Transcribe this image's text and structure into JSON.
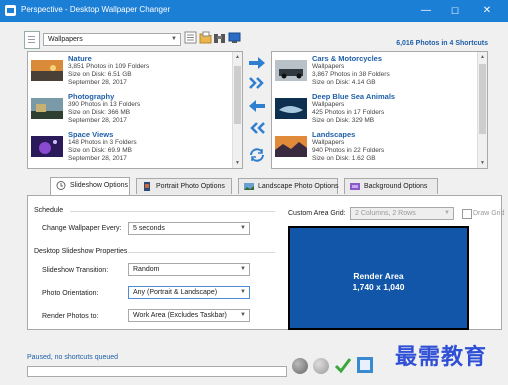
{
  "window": {
    "title": "Perspective - Desktop Wallpaper Changer",
    "minimize": "—",
    "maximize": "☐",
    "close": "✕"
  },
  "toolbar": {
    "shortcut_value": "Wallpapers",
    "shortcut_count": "6,016 Photos in 4 Shortcuts"
  },
  "left_list": {
    "items": [
      {
        "title": "Nature",
        "line1": "3,851 Photos in 109 Folders",
        "line2": "Size on Disk: 6.51 GB",
        "line3": "September 28, 2017"
      },
      {
        "title": "Photography",
        "line1": "390 Photos in 13 Folders",
        "line2": "Size on Disk: 366 MB",
        "line3": "September 28, 2017"
      },
      {
        "title": "Space Views",
        "line1": "148 Photos in 3 Folders",
        "line2": "Size on Disk: 69.9 MB",
        "line3": "September 28, 2017"
      }
    ]
  },
  "right_list": {
    "items": [
      {
        "title": "Cars & Motorcycles",
        "line1": "Wallpapers",
        "line2": "3,867 Photos in 38 Folders",
        "line3": "Size on Disk: 4.14 GB"
      },
      {
        "title": "Deep Blue Sea Animals",
        "line1": "Wallpapers",
        "line2": "425 Photos in 17 Folders",
        "line3": "Size on Disk: 329 MB"
      },
      {
        "title": "Landscapes",
        "line1": "Wallpapers",
        "line2": "940 Photos in 22 Folders",
        "line3": "Size on Disk: 1.62 GB"
      }
    ]
  },
  "tabs": [
    {
      "label": "Slideshow Options"
    },
    {
      "label": "Portrait Photo Options"
    },
    {
      "label": "Landscape Photo Options"
    },
    {
      "label": "Background Options"
    }
  ],
  "slideshow": {
    "schedule_heading": "Schedule",
    "change_label": "Change Wallpaper Every:",
    "change_value": "5 seconds",
    "props_heading": "Desktop Slideshow Properties",
    "transition_label": "Slideshow Transition:",
    "transition_value": "Random",
    "orientation_label": "Photo Orientation:",
    "orientation_value": "Any (Portrait & Landscape)",
    "render_to_label": "Render Photos to:",
    "render_to_value": "Work Area (Excludes Taskbar)"
  },
  "grid": {
    "label": "Custom Area Grid:",
    "value": "2 Columns, 2 Rows",
    "draw_label": "Draw Grid"
  },
  "render_area": {
    "title": "Render Area",
    "size": "1,740 x 1,040"
  },
  "status": {
    "text": "Paused, no shortcuts queued"
  },
  "watermark": {
    "text": "最需教育"
  },
  "colors": {
    "titlebar": "#1c7fd6",
    "accent_text": "#1f5fa8",
    "render_area": "#1156a8"
  }
}
